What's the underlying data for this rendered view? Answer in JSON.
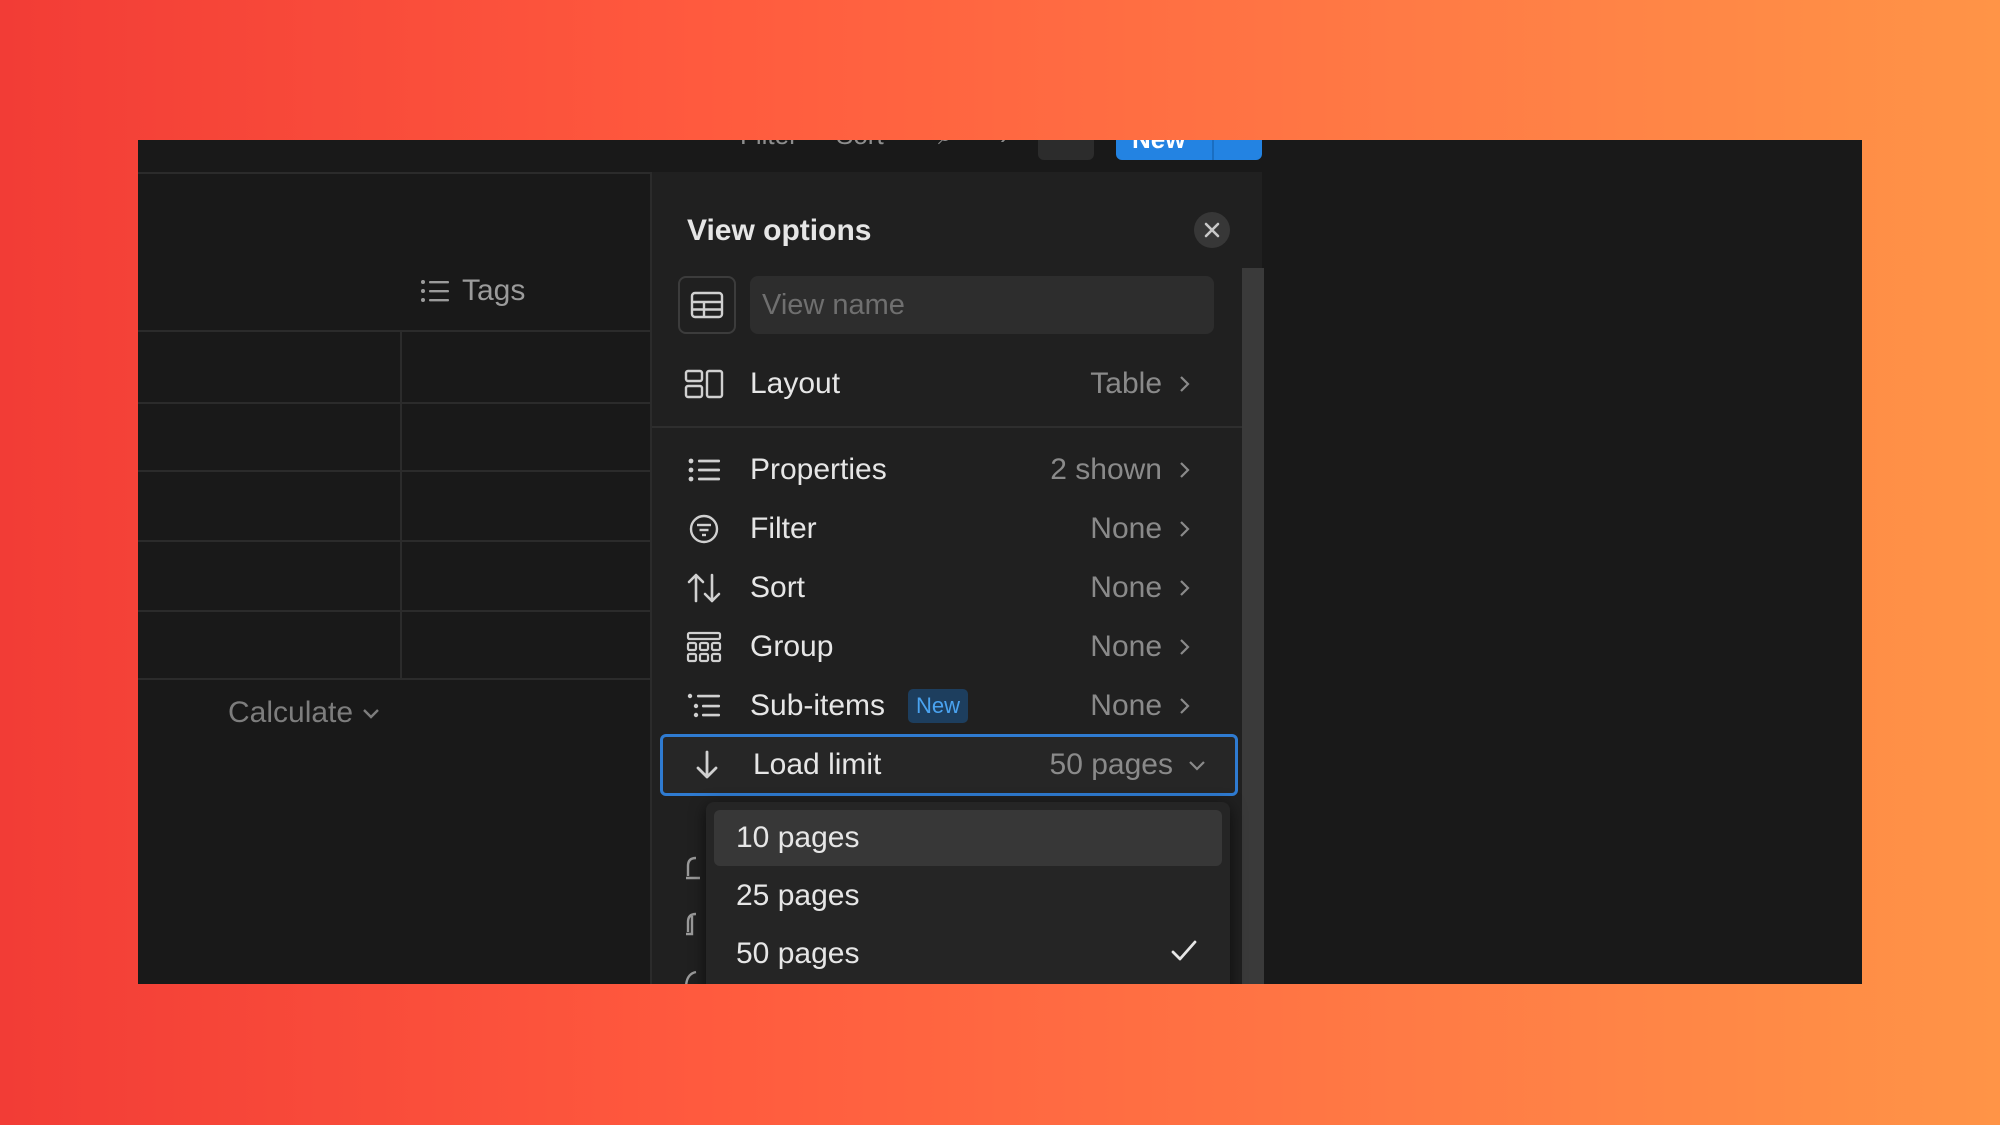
{
  "toolbar": {
    "filter_label": "Filter",
    "sort_label": "Sort",
    "new_label": "New"
  },
  "table": {
    "column_header": "Tags",
    "calculate_label": "Calculate"
  },
  "view_options": {
    "title": "View options",
    "view_name_placeholder": "View name",
    "rows": [
      {
        "label": "Layout",
        "value": "Table",
        "icon": "layout-icon"
      },
      {
        "label": "Properties",
        "value": "2 shown",
        "icon": "list-icon"
      },
      {
        "label": "Filter",
        "value": "None",
        "icon": "filter-icon"
      },
      {
        "label": "Sort",
        "value": "None",
        "icon": "sort-icon"
      },
      {
        "label": "Group",
        "value": "None",
        "icon": "group-icon"
      },
      {
        "label": "Sub-items",
        "value": "None",
        "icon": "sub-items-icon",
        "badge": "New"
      },
      {
        "label": "Load limit",
        "value": "50 pages",
        "icon": "arrow-down-icon"
      }
    ],
    "load_limit_options": [
      {
        "label": "10 pages",
        "selected": false
      },
      {
        "label": "25 pages",
        "selected": false
      },
      {
        "label": "50 pages",
        "selected": true
      }
    ]
  },
  "colors": {
    "accent": "#2383e2",
    "background": "#191919",
    "panel": "#202020",
    "badge_text": "#4aa3f0"
  }
}
